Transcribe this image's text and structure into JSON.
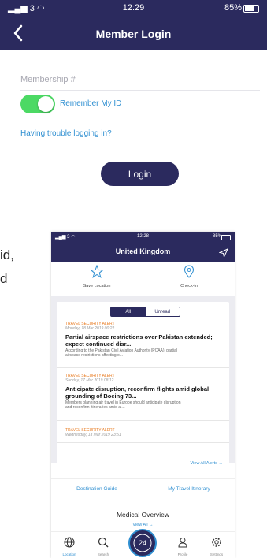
{
  "login": {
    "status": {
      "signal": "3",
      "time": "12:29",
      "battery": "85%"
    },
    "title": "Member Login",
    "membership_placeholder": "Membership #",
    "remember_label": "Remember My ID",
    "remember_on": true,
    "trouble_link": "Having trouble logging in?",
    "login_button": "Login"
  },
  "cropped_text": {
    "line1": "id,",
    "line2": "d"
  },
  "uk": {
    "status": {
      "signal": "3",
      "time": "12:28",
      "battery": "85%"
    },
    "title": "United Kingdom",
    "actions": [
      {
        "label": "Save Location",
        "icon": "star-icon"
      },
      {
        "label": "Check-in",
        "icon": "map-pin-icon"
      }
    ],
    "segments": {
      "all": "All",
      "unread": "Unread"
    },
    "alerts": [
      {
        "tag": "TRAVEL SECURITY ALERT",
        "date": "Monday, 18 Mar 2019 00:22",
        "headline_1": "Partial airspace restrictions over Pakistan extended;",
        "headline_2": "expect continued disr...",
        "body_1": "According to the Pakistan Civil Aviation Authority (PCAA), partial",
        "body_2": "airspace restrictions affecting o..."
      },
      {
        "tag": "TRAVEL SECURITY ALERT",
        "date": "Sunday, 17 Mar 2019 08:12",
        "headline_1": "Anticipate disruption, reconfirm flights amid global",
        "headline_2": "grounding of Boeing 73...",
        "body_1": "Members planning air travel in Europe should anticipate disruption",
        "body_2": "and reconfirm itineraries amid a ..."
      },
      {
        "tag": "TRAVEL SECURITY ALERT",
        "date": "Wednesday, 13 Mar 2019 23:51"
      }
    ],
    "view_all_alerts": "View All Alerts →",
    "links": {
      "destination_guide": "Destination Guide",
      "itinerary": "My Travel Itinerary"
    },
    "medical_title": "Medical Overview",
    "medical_view_all": "View All →",
    "tabs": [
      {
        "label": "Location",
        "icon": "globe-icon"
      },
      {
        "label": "Search",
        "icon": "search-icon"
      },
      {
        "label": "24",
        "icon": "phone-24-icon"
      },
      {
        "label": "Profile",
        "icon": "person-icon"
      },
      {
        "label": "Settings",
        "icon": "gear-icon"
      }
    ],
    "accent": "#2b2a5e",
    "link_color": "#2f8fd1",
    "alert_color": "#e87a1f"
  }
}
